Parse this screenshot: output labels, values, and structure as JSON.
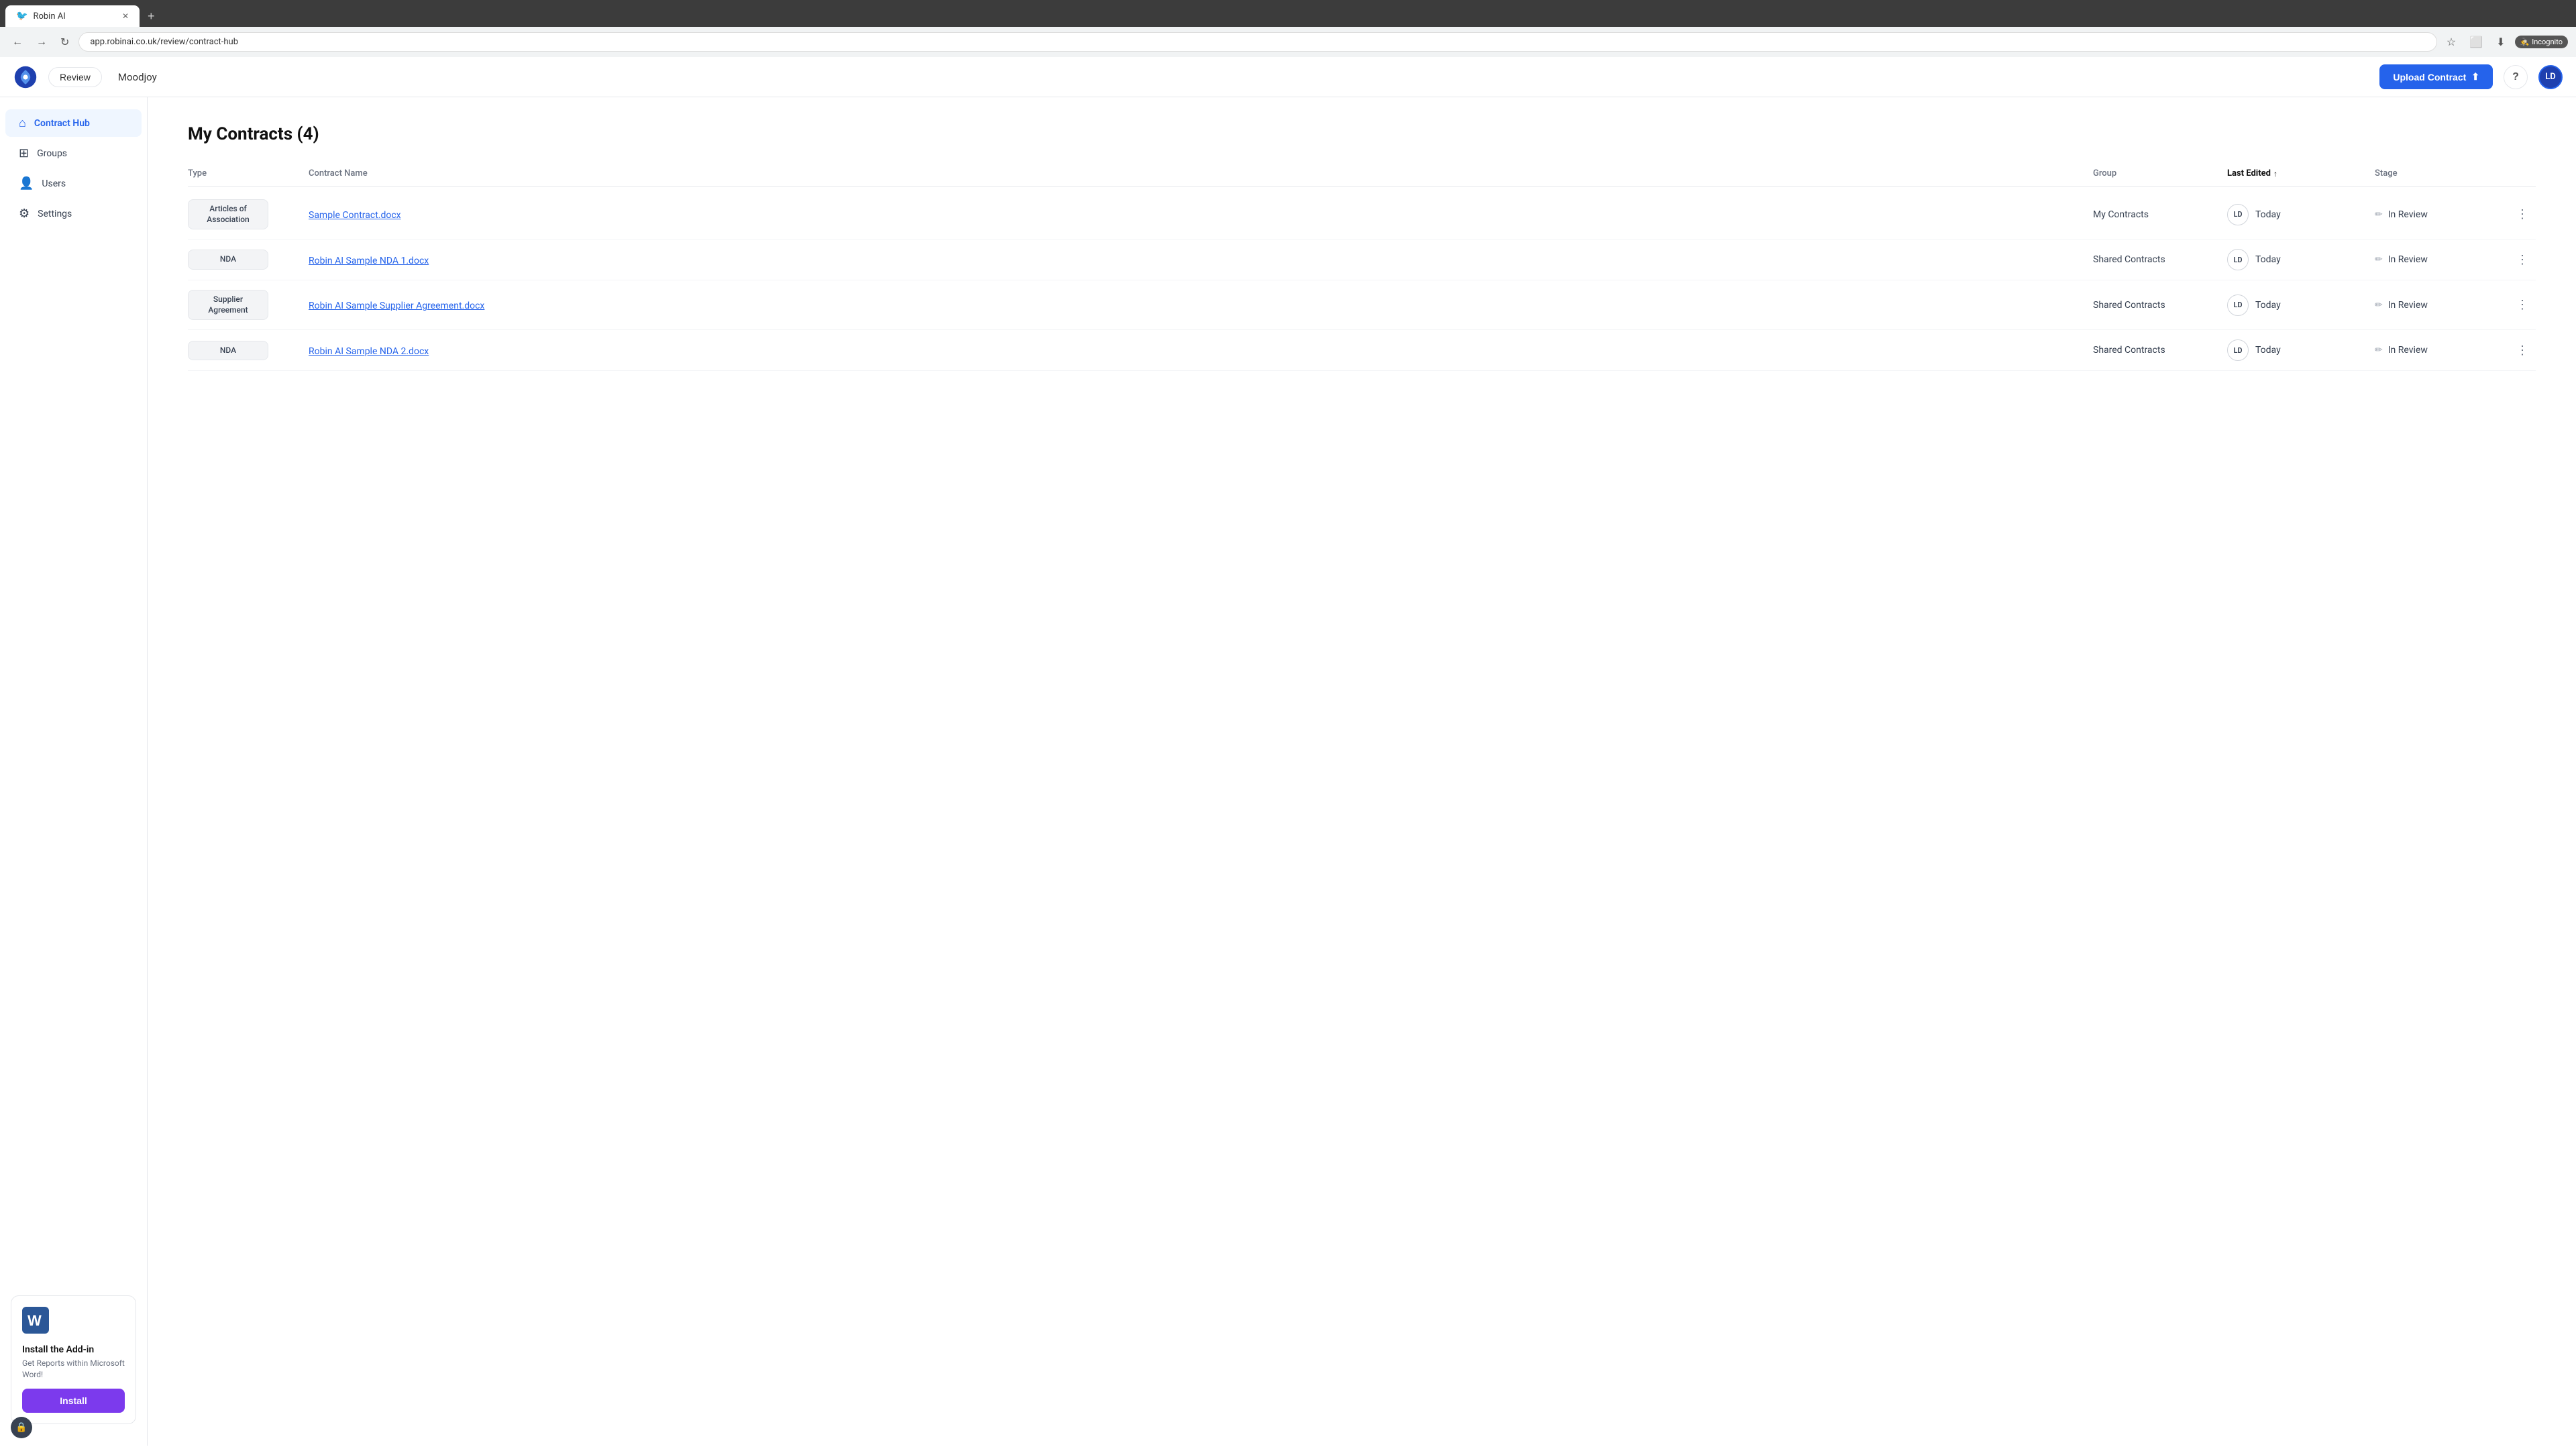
{
  "browser": {
    "tab_label": "Robin AI",
    "new_tab_symbol": "+",
    "url": "app.robinai.co.uk/review/contract-hub",
    "incognito_label": "Incognito"
  },
  "header": {
    "review_label": "Review",
    "company_name": "Moodjoy",
    "upload_btn_label": "Upload Contract",
    "upload_icon": "↑",
    "help_icon": "?",
    "user_initials": "LD"
  },
  "sidebar": {
    "items": [
      {
        "id": "contract-hub",
        "label": "Contract Hub",
        "active": true
      },
      {
        "id": "groups",
        "label": "Groups",
        "active": false
      },
      {
        "id": "users",
        "label": "Users",
        "active": false
      },
      {
        "id": "settings",
        "label": "Settings",
        "active": false
      }
    ]
  },
  "addin": {
    "title": "Install the Add-in",
    "description": "Get Reports within Microsoft Word!",
    "install_label": "Install"
  },
  "main": {
    "page_title": "My Contracts (4)",
    "table": {
      "headers": [
        {
          "id": "type",
          "label": "Type",
          "sortable": false
        },
        {
          "id": "contract_name",
          "label": "Contract Name",
          "sortable": false
        },
        {
          "id": "group",
          "label": "Group",
          "sortable": false
        },
        {
          "id": "last_edited",
          "label": "Last Edited",
          "sortable": true
        },
        {
          "id": "stage",
          "label": "Stage",
          "sortable": false
        }
      ],
      "rows": [
        {
          "type": "Articles of\nAssociation",
          "contract_name": "Sample Contract.docx",
          "group": "My Contracts",
          "avatar": "LD",
          "last_edited": "Today",
          "stage": "In Review"
        },
        {
          "type": "NDA",
          "contract_name": "Robin AI Sample NDA 1.docx",
          "group": "Shared Contracts",
          "avatar": "LD",
          "last_edited": "Today",
          "stage": "In Review"
        },
        {
          "type": "Supplier\nAgreement",
          "contract_name": "Robin AI Sample Supplier Agreement.docx",
          "group": "Shared Contracts",
          "avatar": "LD",
          "last_edited": "Today",
          "stage": "In Review"
        },
        {
          "type": "NDA",
          "contract_name": "Robin AI Sample NDA 2.docx",
          "group": "Shared Contracts",
          "avatar": "LD",
          "last_edited": "Today",
          "stage": "In Review"
        }
      ]
    }
  },
  "privacy_icon": "🔒"
}
